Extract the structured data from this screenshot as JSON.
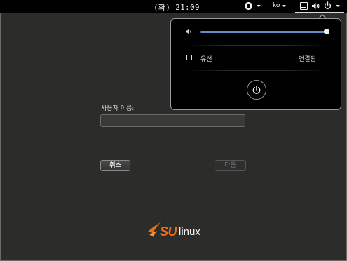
{
  "topbar": {
    "clock": "(화) 21:09",
    "language": "ko",
    "icons": [
      "accessibility-icon",
      "system-status-icon",
      "volume-icon",
      "power-icon"
    ]
  },
  "system_menu": {
    "volume": {
      "level": 1.0,
      "icon": "volume-low-icon",
      "accent": "#5b8fd0"
    },
    "network": {
      "label": "유선",
      "status": "연결됨",
      "icon": "wired-network-icon"
    },
    "power_button": {
      "icon": "power-icon"
    }
  },
  "login": {
    "username_label": "사용자 이름:",
    "username_value": "",
    "cancel_label": "취소",
    "next_label": "다음"
  },
  "logo": {
    "brand_su": "SU",
    "brand_linux": "linux",
    "brand_color": "#f06d14"
  }
}
